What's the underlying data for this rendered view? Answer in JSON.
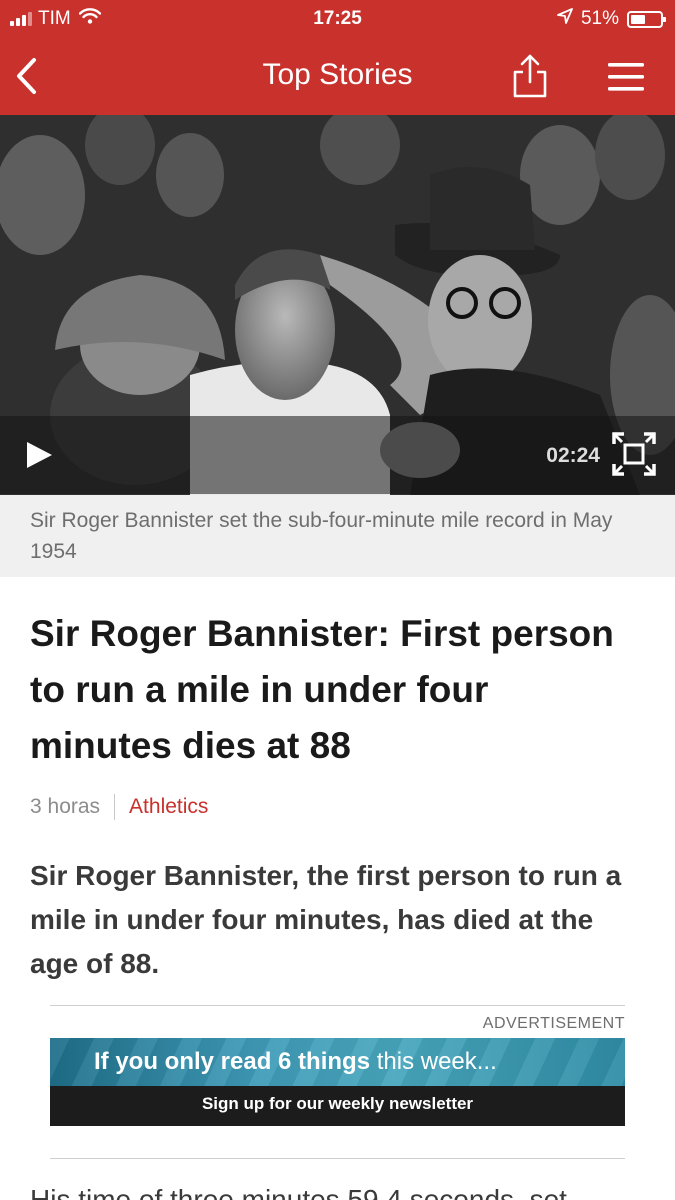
{
  "status_bar": {
    "carrier": "TIM",
    "time": "17:25",
    "battery": "51%",
    "battery_level": 0.51,
    "icons": [
      "signal-icon",
      "wifi-icon",
      "location-arrow-icon",
      "battery-icon"
    ]
  },
  "nav": {
    "title": "Top Stories",
    "icons": [
      "back-chevron-icon",
      "share-icon",
      "hamburger-menu-icon"
    ]
  },
  "video": {
    "duration": "02:24",
    "icons": [
      "play-icon",
      "fullscreen-icon"
    ]
  },
  "caption": "Sir Roger Bannister set the sub-four-minute mile record in May 1954",
  "article": {
    "headline": "Sir Roger Bannister: First person to run a mile in under four minutes dies at 88",
    "age": "3 horas",
    "category": "Athletics",
    "summary": "Sir Roger Bannister, the first person to run a mile in under four minutes, has died at the age of 88.",
    "next_paragraph": "His time of three minutes 59.4 seconds, set"
  },
  "advertisement": {
    "label": "ADVERTISEMENT",
    "headline_bold": "If you only read 6 things",
    "headline_light": " this week...",
    "cta": "Sign up for our weekly newsletter"
  },
  "colors": {
    "brand_red": "#c8312c",
    "caption_bg": "#f0f0f0",
    "category": "#c8312c"
  }
}
